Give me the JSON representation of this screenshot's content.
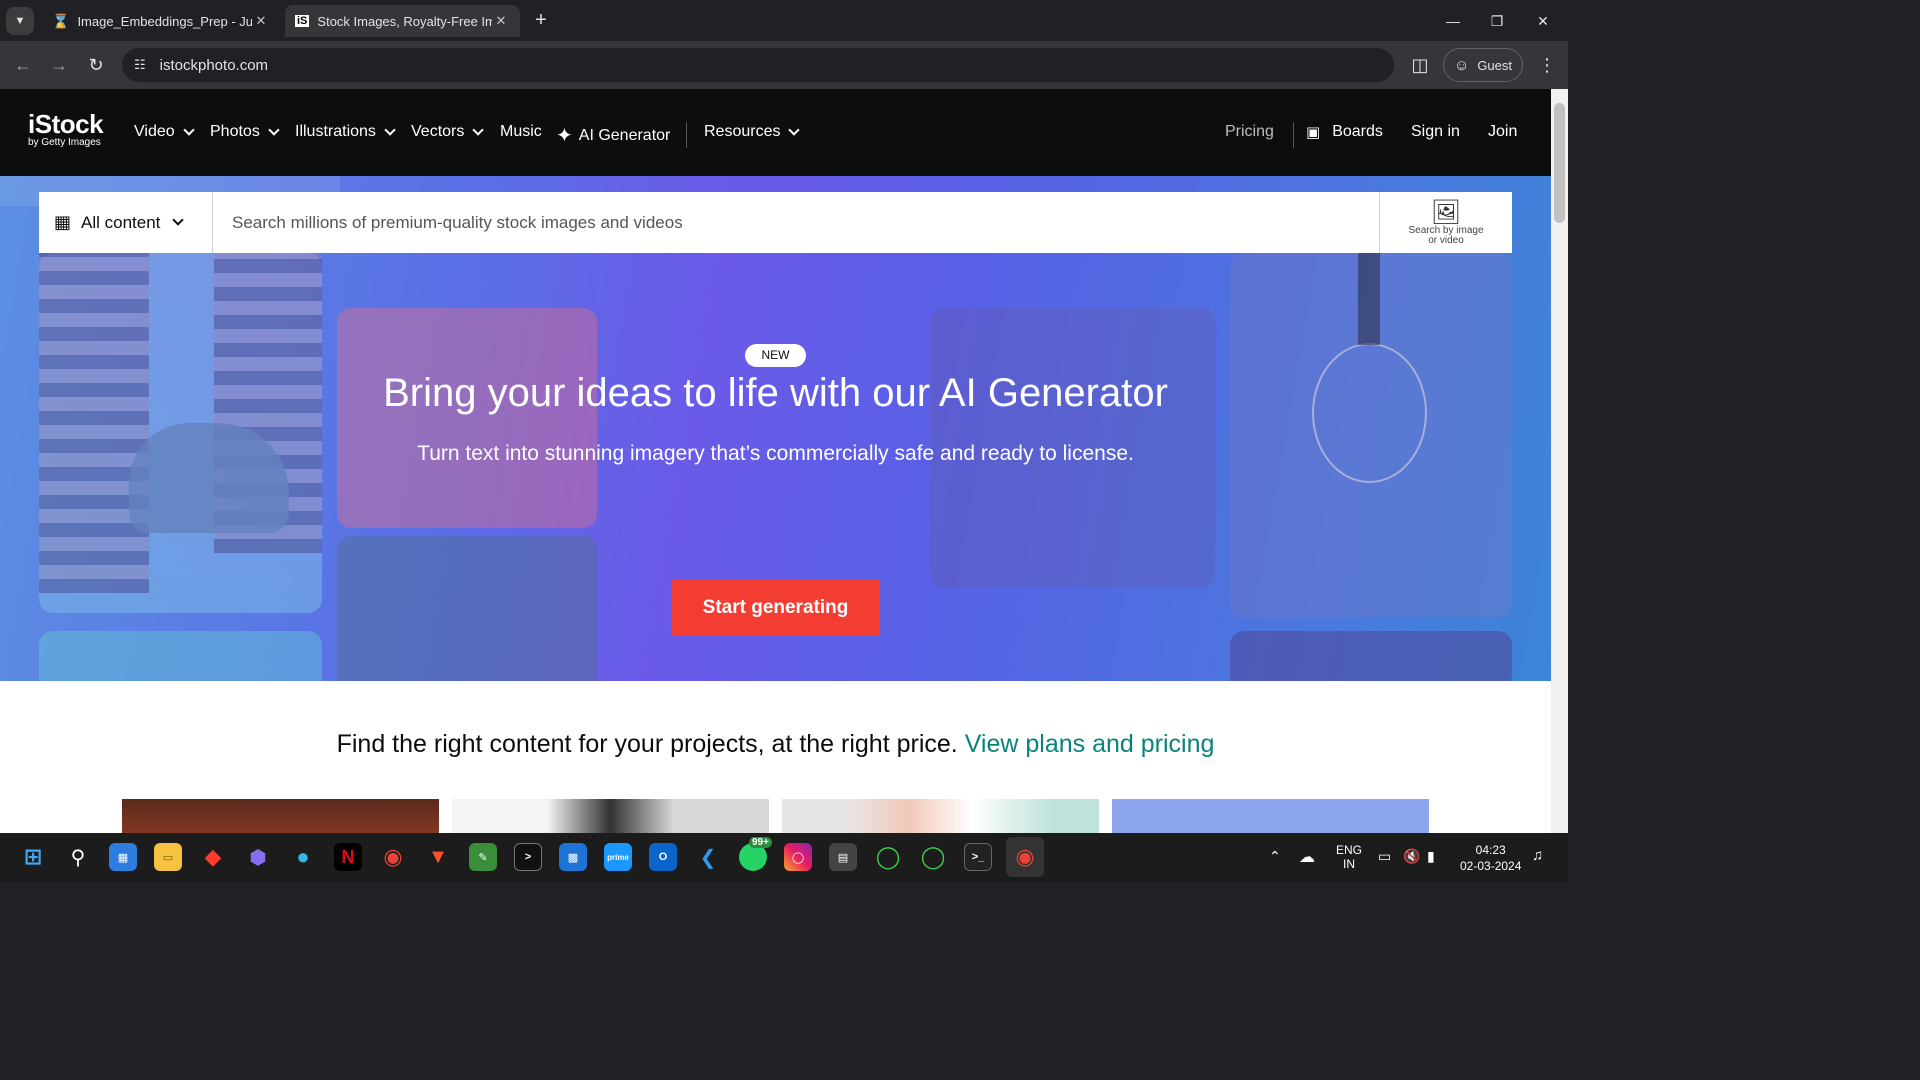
{
  "browser": {
    "tabs": [
      {
        "title": "Image_Embeddings_Prep - Jupy",
        "active": false
      },
      {
        "title": "Stock Images, Royalty-Free Ima",
        "active": true
      }
    ],
    "url": "istockphoto.com",
    "profile_label": "Guest"
  },
  "site": {
    "logo": {
      "main": "iStock",
      "sub": "by Getty Images"
    },
    "nav": {
      "video": "Video",
      "photos": "Photos",
      "illustrations": "Illustrations",
      "vectors": "Vectors",
      "music": "Music",
      "ai_generator": "AI Generator",
      "resources": "Resources",
      "pricing": "Pricing",
      "boards": "Boards",
      "sign_in": "Sign in",
      "join": "Join"
    },
    "search": {
      "filter_label": "All content",
      "placeholder": "Search millions of premium-quality stock images and videos",
      "search_by_image_line1": "Search by image",
      "search_by_image_line2": "or video"
    },
    "hero": {
      "badge": "NEW",
      "title": "Bring your ideas to life with our AI Generator",
      "subtitle": "Turn text into stunning imagery that’s commercially safe and ready to license.",
      "cta": "Start generating"
    },
    "pricing_line": {
      "text": "Find the right content for your projects, at the right price.",
      "link": "View plans and pricing"
    }
  },
  "taskbar": {
    "icons": [
      "windows-start",
      "search",
      "store",
      "files",
      "app-red",
      "copilot",
      "edge",
      "netflix",
      "chrome",
      "brave",
      "notepad",
      "terminal",
      "app-blue",
      "prime-video",
      "outlook",
      "vscode",
      "whatsapp",
      "instagram",
      "console",
      "spinner",
      "spinner",
      "cmd",
      "chrome"
    ],
    "whatsapp_badge": "99+",
    "lang_line1": "ENG",
    "lang_line2": "IN",
    "time": "04:23",
    "date": "02-03-2024"
  },
  "colors": {
    "cta": "#f33d33",
    "link": "#08847a",
    "header_bg": "#0c0d0d"
  }
}
